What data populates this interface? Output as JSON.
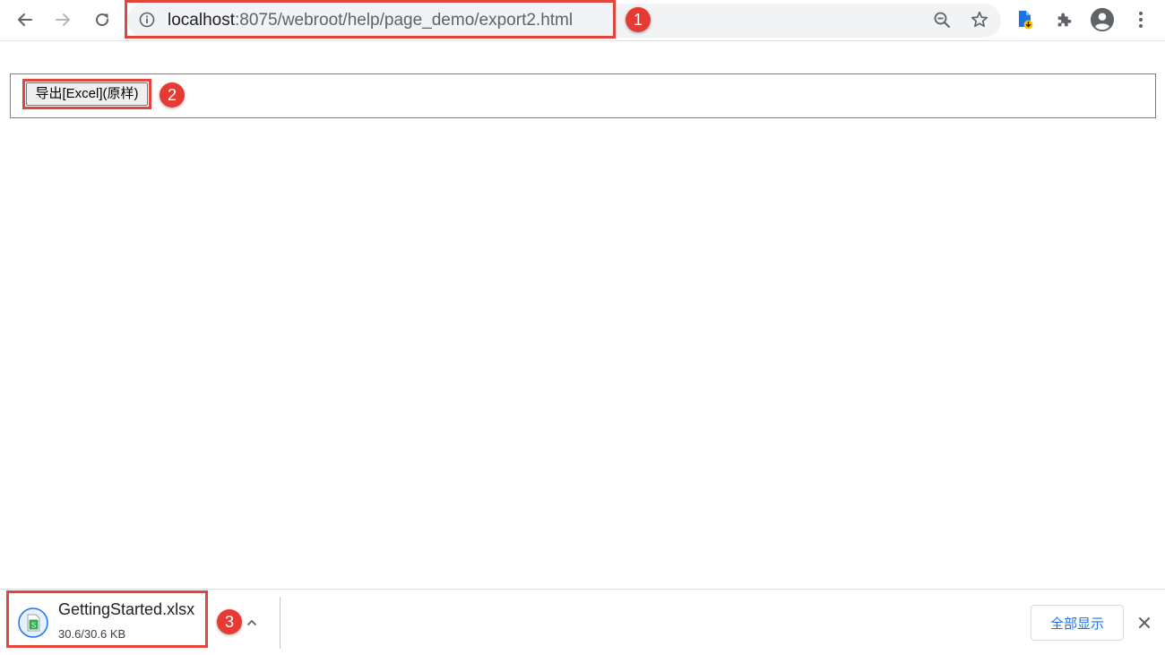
{
  "browser": {
    "url_host": "localhost",
    "url_rest": ":8075/webroot/help/page_demo/export2.html",
    "icons": {
      "back": "back-arrow-icon",
      "forward": "forward-arrow-icon",
      "reload": "reload-icon",
      "site_info": "info-icon",
      "zoom": "zoom-out-icon",
      "bookmark": "star-icon",
      "extension": "extension-icon",
      "puzzle": "puzzle-icon",
      "profile": "profile-icon",
      "menu": "kebab-menu-icon"
    }
  },
  "page": {
    "export_button_label": "导出[Excel](原样)"
  },
  "download_bar": {
    "file_name": "GettingStarted.xlsx",
    "progress": "30.6/30.6 KB",
    "show_all_label": "全部显示"
  },
  "annotations": {
    "badge_1": "1",
    "badge_2": "2",
    "badge_3": "3"
  },
  "colors": {
    "callout_red": "#e0453e",
    "badge_red": "#e63b34",
    "link_blue": "#1a73e8"
  }
}
